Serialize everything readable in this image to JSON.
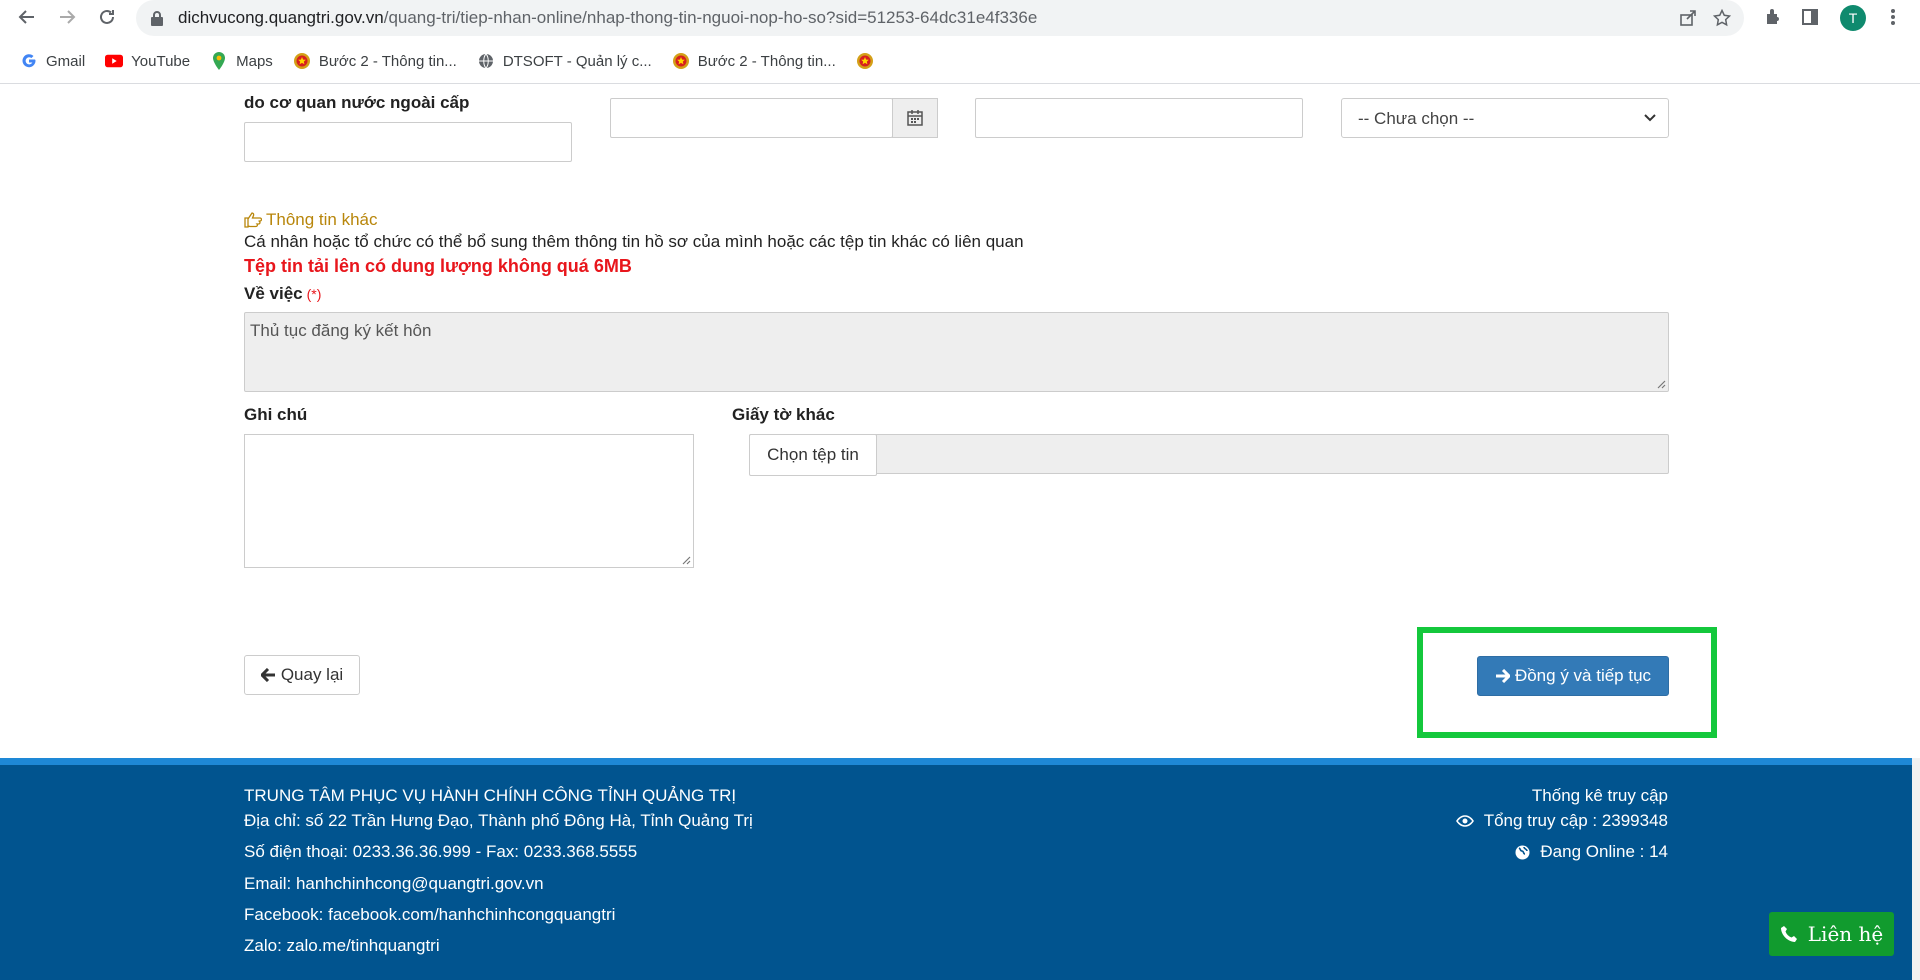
{
  "browser": {
    "url_host": "dichvucong.quangtri.gov.vn",
    "url_path": "/quang-tri/tiep-nhan-online/nhap-thong-tin-nguoi-nop-ho-so?sid=51253-64dc31e4f336e",
    "avatar_letter": "T",
    "bookmarks": [
      {
        "label": "Gmail",
        "icon": "gmail-icon"
      },
      {
        "label": "YouTube",
        "icon": "youtube-icon"
      },
      {
        "label": "Maps",
        "icon": "maps-icon"
      },
      {
        "label": "Bước 2 - Thông tin...",
        "icon": "emblem-icon"
      },
      {
        "label": "DTSOFT - Quản lý c...",
        "icon": "globe-icon"
      },
      {
        "label": "Bước 2 - Thông tin...",
        "icon": "emblem-icon"
      },
      {
        "label": "",
        "icon": "emblem-icon"
      }
    ]
  },
  "form_top": {
    "col1_label": "do cơ quan nước ngoài cấp",
    "nationality_select": "-- Chưa chọn --"
  },
  "other_info": {
    "section_title": "Thông tin khác",
    "description": "Cá nhân hoặc tổ chức có thể bổ sung thêm thông tin hồ sơ của mình hoặc các tệp tin khác có liên quan",
    "file_warning": "Tệp tin tải lên có dung lượng không quá 6MB",
    "subject_label": "Về việc",
    "required_mark": "(*)",
    "subject_value": "Thủ tục đăng ký kết hôn",
    "note_label": "Ghi chú",
    "other_docs_label": "Giấy tờ khác",
    "choose_file": "Chọn tệp tin"
  },
  "actions": {
    "back": "Quay lại",
    "continue": "Đồng ý và tiếp tục"
  },
  "footer": {
    "org": "TRUNG TÂM PHỤC VỤ HÀNH CHÍNH CÔNG TỈNH QUẢNG TRỊ",
    "address": "Địa chỉ: số 22 Trần Hưng Đạo, Thành phố Đông Hà, Tỉnh Quảng Trị",
    "phone": "Số điện thoại: 0233.36.36.999 - Fax: 0233.368.5555",
    "email": "Email: hanhchinhcong@quangtri.gov.vn",
    "facebook": "Facebook: facebook.com/hanhchinhcongquangtri",
    "zalo": "Zalo: zalo.me/tinhquangtri",
    "stats_title": "Thống kê truy cập",
    "total_visits": "Tổng truy cập : 2399348",
    "online": "Đang Online : 14"
  },
  "contact_button": "Liên hệ",
  "colors": {
    "primary": "#337ab7",
    "footer_bg": "#01548f",
    "warning": "#e8161c",
    "highlight": "#14c83c",
    "contact": "#119b2e"
  }
}
